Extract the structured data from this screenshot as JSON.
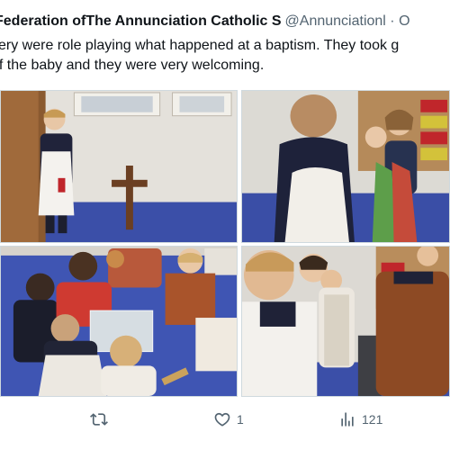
{
  "tweet": {
    "author_name": "Federation ofThe Annunciation Catholic S",
    "author_handle": "@Annunciationl · O",
    "text_line1": "sery were role playing what happened at a baptism. They took g",
    "text_line2": "of the baby and they were very welcoming."
  },
  "actions": {
    "retweet_icon": "retweet-icon",
    "like_icon": "heart-icon",
    "like_count": "1",
    "views_icon": "analytics-icon",
    "views_count": "121"
  },
  "colors": {
    "text": "#0f1419",
    "secondary": "#536471",
    "border": "#cfd9de"
  }
}
